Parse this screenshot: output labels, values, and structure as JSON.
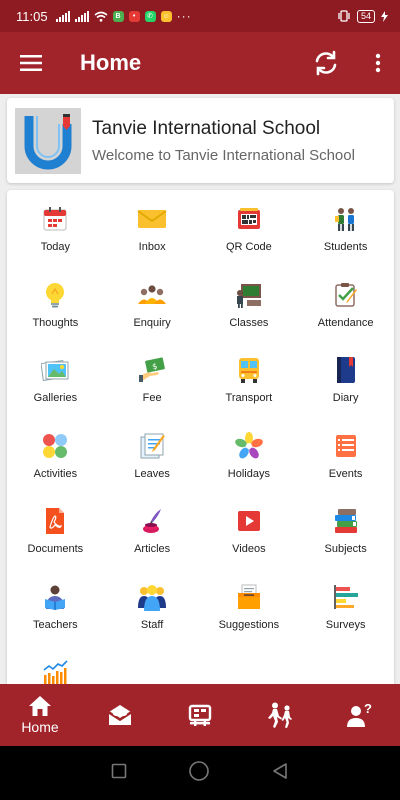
{
  "status": {
    "time": "11:05",
    "overflow": "···",
    "battery": "54"
  },
  "app_bar": {
    "title": "Home",
    "menu_icon": "hamburger-menu-icon",
    "refresh_icon": "sync-icon",
    "more_icon": "more-vert-icon"
  },
  "school": {
    "name": "Tanvie International School",
    "welcome": "Welcome to Tanvie International School"
  },
  "modules": [
    {
      "label": "Today",
      "icon": "calendar-icon"
    },
    {
      "label": "Inbox",
      "icon": "envelope-icon"
    },
    {
      "label": "QR Code",
      "icon": "qr-scanner-icon"
    },
    {
      "label": "Students",
      "icon": "students-icon"
    },
    {
      "label": "Thoughts",
      "icon": "lightbulb-icon"
    },
    {
      "label": "Enquiry",
      "icon": "group-icon"
    },
    {
      "label": "Classes",
      "icon": "classroom-icon"
    },
    {
      "label": "Attendance",
      "icon": "attendance-icon"
    },
    {
      "label": "Galleries",
      "icon": "photos-icon"
    },
    {
      "label": "Fee",
      "icon": "money-icon"
    },
    {
      "label": "Transport",
      "icon": "bus-icon"
    },
    {
      "label": "Diary",
      "icon": "diary-icon"
    },
    {
      "label": "Activities",
      "icon": "circles-icon"
    },
    {
      "label": "Leaves",
      "icon": "leave-form-icon"
    },
    {
      "label": "Holidays",
      "icon": "flower-icon"
    },
    {
      "label": "Events",
      "icon": "events-icon"
    },
    {
      "label": "Documents",
      "icon": "pdf-document-icon"
    },
    {
      "label": "Articles",
      "icon": "ink-pen-icon"
    },
    {
      "label": "Videos",
      "icon": "video-play-icon"
    },
    {
      "label": "Subjects",
      "icon": "books-icon"
    },
    {
      "label": "Teachers",
      "icon": "teacher-reading-icon"
    },
    {
      "label": "Staff",
      "icon": "staff-group-icon"
    },
    {
      "label": "Suggestions",
      "icon": "suggestion-box-icon"
    },
    {
      "label": "Surveys",
      "icon": "survey-bars-icon"
    },
    {
      "label": "",
      "icon": "analytics-chart-icon"
    }
  ],
  "bottom_nav": [
    {
      "label": "Home",
      "icon": "home-icon"
    },
    {
      "label": "",
      "icon": "mail-open-icon"
    },
    {
      "label": "",
      "icon": "timetable-icon"
    },
    {
      "label": "",
      "icon": "walking-students-icon"
    },
    {
      "label": "",
      "icon": "help-person-icon"
    }
  ],
  "colors": {
    "status_bar": "#8e1b21",
    "primary": "#a0242a"
  }
}
